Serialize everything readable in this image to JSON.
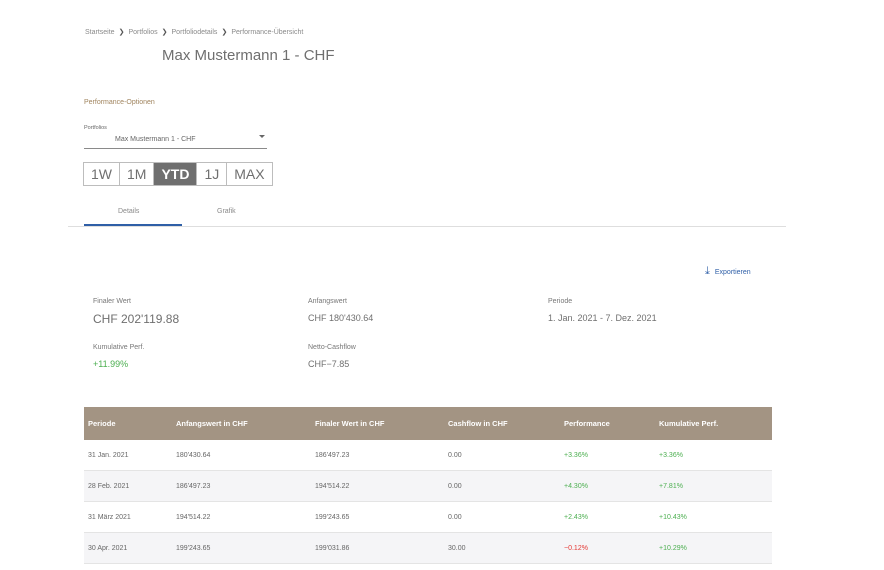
{
  "breadcrumb": {
    "items": [
      "Startseite",
      "Portfolios",
      "Portfoliodetails",
      "Performance-Übersicht"
    ],
    "separator": ">"
  },
  "page_title": "Max Mustermann 1 - CHF",
  "options_title": "Performance-Optionen",
  "portfolio_select": {
    "label": "Portfolios",
    "value": "Max Mustermann 1 - CHF"
  },
  "periods": {
    "items": [
      "1W",
      "1M",
      "YTD",
      "1J",
      "MAX"
    ],
    "active": "YTD"
  },
  "tabs": {
    "items": [
      "Details",
      "Grafik"
    ],
    "active": "Details"
  },
  "export_label": "Exportieren",
  "summary": {
    "final_value_label": "Finaler Wert",
    "final_value": "CHF 202'119.88",
    "start_value_label": "Anfangswert",
    "start_value": "CHF 180'430.64",
    "period_label": "Periode",
    "period_value": "1. Jan. 2021 - 7. Dez. 2021",
    "cum_perf_label": "Kumulative Perf.",
    "cum_perf_value": "+11.99%",
    "net_cashflow_label": "Netto-Cashflow",
    "net_cashflow_value": "CHF−7.85"
  },
  "table": {
    "headers": [
      "Periode",
      "Anfangswert in CHF",
      "Finaler Wert in CHF",
      "Cashflow in CHF",
      "Performance",
      "Kumulative Perf."
    ],
    "rows": [
      [
        "31 Jan. 2021",
        "180'430.64",
        "186'497.23",
        "0.00",
        "+3.36%",
        "+3.36%"
      ],
      [
        "28 Feb. 2021",
        "186'497.23",
        "194'514.22",
        "0.00",
        "+4.30%",
        "+7.81%"
      ],
      [
        "31 März 2021",
        "194'514.22",
        "199'243.65",
        "0.00",
        "+2.43%",
        "+10.43%"
      ],
      [
        "30 Apr. 2021",
        "199'243.65",
        "199'031.86",
        "30.00",
        "−0.12%",
        "+10.29%"
      ]
    ]
  },
  "colors": {
    "accent_blue": "#2f5fa7",
    "header_bg": "#a39483",
    "positive": "#4caf50",
    "negative": "#e53935",
    "options_title": "#a0845e"
  }
}
